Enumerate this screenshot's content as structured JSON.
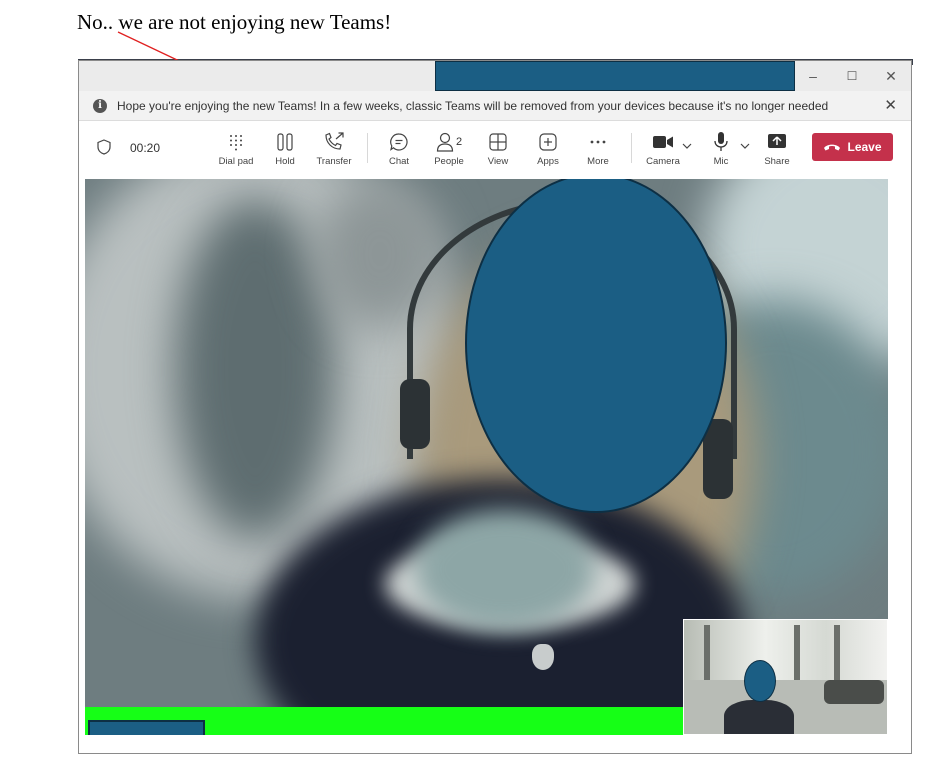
{
  "annotation": {
    "caption": "No.. we are not enjoying new Teams!"
  },
  "window": {
    "controls": {
      "minimize": "–",
      "maximize": "☐",
      "close": "✕"
    }
  },
  "banner": {
    "text": "Hope you're enjoying the new Teams! In a few weeks, classic Teams will be removed from your devices because it's no longer needed",
    "close": "✕"
  },
  "toolbar": {
    "timer": "00:20",
    "people_count": "2",
    "buttons": {
      "dial_pad": "Dial pad",
      "hold": "Hold",
      "transfer": "Transfer",
      "chat": "Chat",
      "people": "People",
      "view": "View",
      "apps": "Apps",
      "more": "More",
      "camera": "Camera",
      "mic": "Mic",
      "share": "Share"
    },
    "leave": "Leave"
  },
  "colors": {
    "leave_red": "#c4314b",
    "redaction_blue": "#1b5e84",
    "overlay_green": "#16ff16",
    "annotation_arrow": "#e02020"
  }
}
